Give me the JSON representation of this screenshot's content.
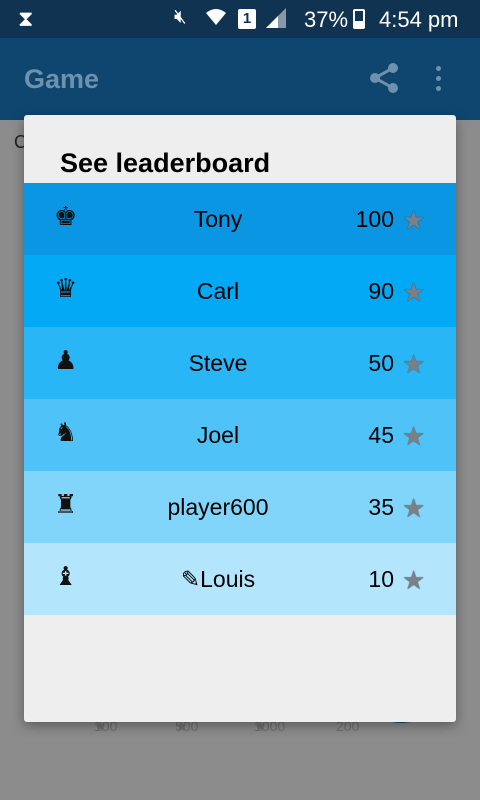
{
  "status_bar": {
    "battery_pct": "37%",
    "time": "4:54 pm",
    "sim_slot": "1",
    "icons": [
      "hourglass-icon",
      "mute-icon",
      "wifi-icon",
      "sim-icon",
      "signal-icon",
      "battery-icon"
    ]
  },
  "app_bar": {
    "title": "Game",
    "icons": [
      "share-icon",
      "more-vert-icon"
    ]
  },
  "background": {
    "partial_text": "C",
    "tiers": [
      "100",
      "500",
      "1000",
      "200"
    ]
  },
  "dialog": {
    "title": "See leaderboard",
    "rows": [
      {
        "piece": "♚",
        "piece_icon": "chess-king-icon",
        "name": "Tony",
        "score": "100",
        "color": "#0a96e3"
      },
      {
        "piece": "♛",
        "piece_icon": "chess-queen-icon",
        "name": "Carl",
        "score": "90",
        "color": "#03a9f4"
      },
      {
        "piece": "♟",
        "piece_icon": "chess-pawn-icon",
        "name": "Steve",
        "score": "50",
        "color": "#29b6f6"
      },
      {
        "piece": "♞",
        "piece_icon": "chess-knight-icon",
        "name": "Joel",
        "score": "45",
        "color": "#4fc3f7"
      },
      {
        "piece": "♜",
        "piece_icon": "chess-rook-icon",
        "name": "player600",
        "score": "35",
        "color": "#81d4fa"
      },
      {
        "piece": "♝",
        "piece_icon": "chess-bishop-icon",
        "name": "✎Louis",
        "score": "10",
        "color": "#b3e5fc"
      }
    ]
  },
  "colors": {
    "status_bar": "#0f3350",
    "app_bar": "#0e466f",
    "dialog_bg": "#eeeeee",
    "scrim": "#8c8c8c"
  }
}
